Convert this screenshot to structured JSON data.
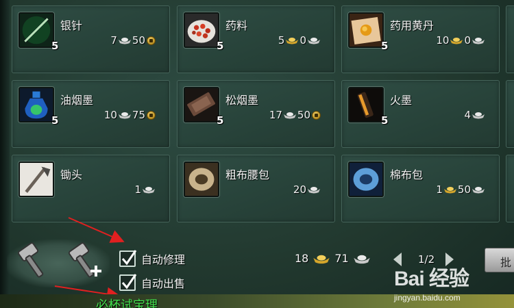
{
  "items": [
    {
      "name": "银针",
      "count": "5",
      "price": [
        "7",
        "50"
      ],
      "currency": [
        "silver",
        "copper"
      ],
      "icon": "silver-needle-icon"
    },
    {
      "name": "药料",
      "count": "5",
      "price": [
        "5",
        "0"
      ],
      "currency": [
        "gold",
        "silver"
      ],
      "icon": "medicine-ingredients-icon"
    },
    {
      "name": "药用黄丹",
      "count": "5",
      "price": [
        "10",
        "0"
      ],
      "currency": [
        "gold",
        "silver"
      ],
      "icon": "yellow-pill-icon"
    },
    {
      "name": "油烟墨",
      "count": "5",
      "price": [
        "10",
        "75"
      ],
      "currency": [
        "silver",
        "copper"
      ],
      "icon": "oil-ink-bottle-icon"
    },
    {
      "name": "松烟墨",
      "count": "5",
      "price": [
        "17",
        "50"
      ],
      "currency": [
        "silver",
        "copper"
      ],
      "icon": "pine-ink-block-icon"
    },
    {
      "name": "火墨",
      "count": "5",
      "price": [
        "4"
      ],
      "currency": [
        "silver"
      ],
      "icon": "fire-ink-icon"
    },
    {
      "name": "锄头",
      "count": "",
      "price": [
        "1"
      ],
      "currency": [
        "silver"
      ],
      "icon": "hoe-icon"
    },
    {
      "name": "粗布腰包",
      "count": "",
      "price": [
        "20"
      ],
      "currency": [
        "silver"
      ],
      "icon": "coarse-cloth-pouch-icon"
    },
    {
      "name": "棉布包",
      "count": "",
      "price": [
        "1",
        "50"
      ],
      "currency": [
        "gold",
        "silver"
      ],
      "icon": "cotton-bag-icon"
    }
  ],
  "options": {
    "auto_repair": {
      "label": "自动修理",
      "checked": true
    },
    "auto_sell": {
      "label": "自动出售",
      "checked": true
    }
  },
  "funds": {
    "gold": "18",
    "silver": "71"
  },
  "pagination": {
    "page": "1/2"
  },
  "batch_button": {
    "label": "批"
  },
  "overlay_text": "必杯试宝理",
  "watermark": {
    "logo": "Bai 经验",
    "url": "jingyan.baidu.com"
  },
  "colors": {
    "panel": "#2a443b",
    "text": "#f2f2f2",
    "annotation_arrow": "#e02020",
    "overlay_text": "#43e14f"
  }
}
